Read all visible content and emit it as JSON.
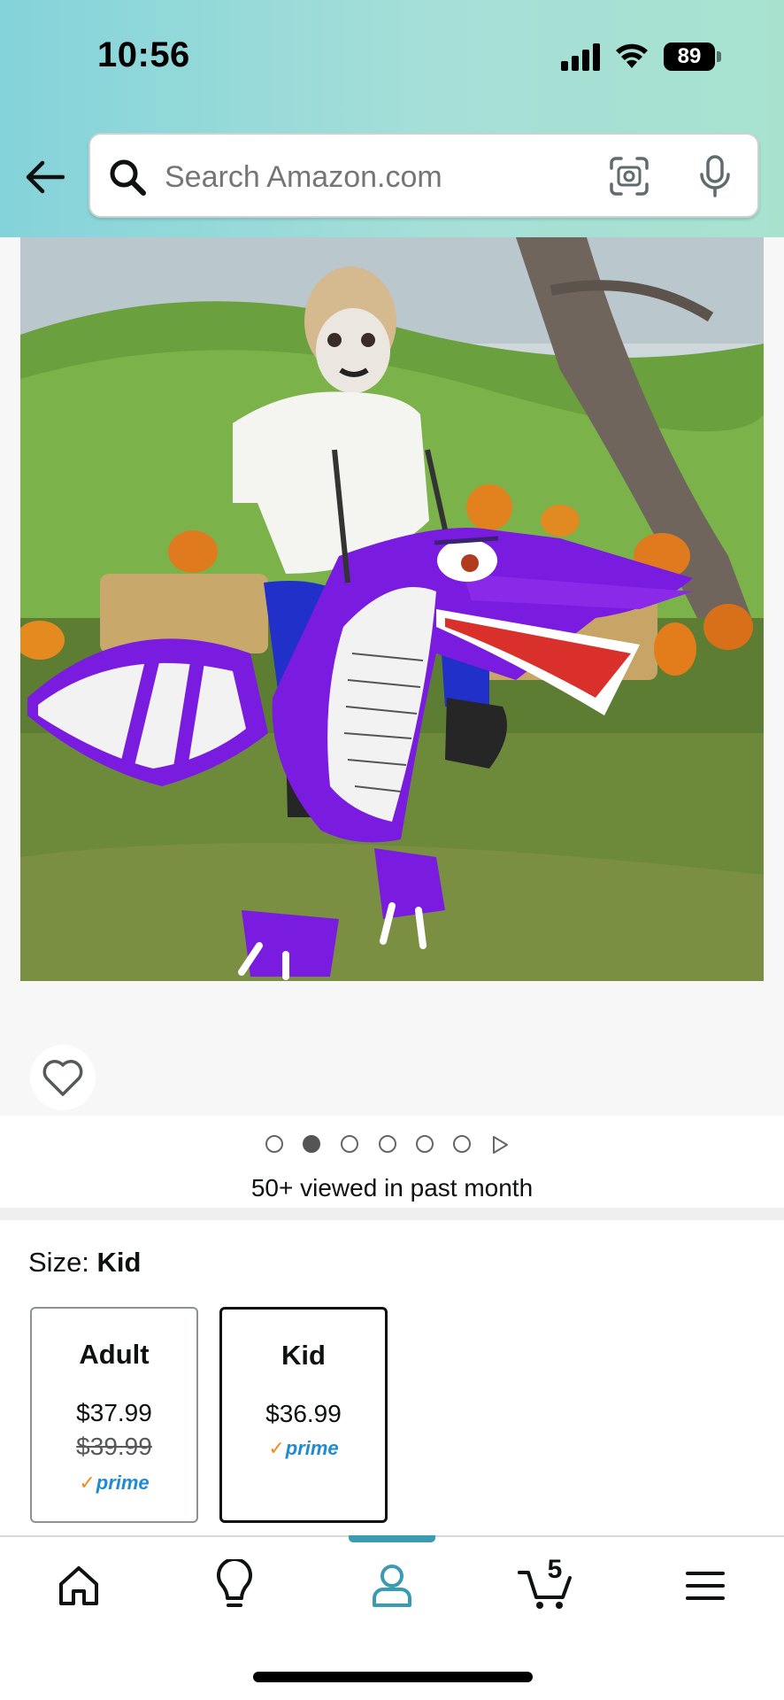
{
  "status_bar": {
    "time": "10:56",
    "battery": "89"
  },
  "header": {
    "search_placeholder": "Search Amazon.com"
  },
  "gallery": {
    "dot_count": 6,
    "active_dot": 1
  },
  "social_proof": "50+ viewed in past month",
  "size_selector": {
    "label": "Size: ",
    "selected": "Kid",
    "options": [
      {
        "name": "Adult",
        "price": "$37.99",
        "list_price": "$39.99",
        "badge": "prime"
      },
      {
        "name": "Kid",
        "price": "$36.99",
        "badge": "prime"
      }
    ]
  },
  "bottom_nav": {
    "cart_count": "5",
    "active": "account"
  },
  "colors": {
    "header_start": "#84d3da",
    "header_end": "#a8e2cf",
    "prime_blue": "#1f8bd3",
    "prime_check": "#f08c1e",
    "nav_accent": "#3b9bb2"
  }
}
